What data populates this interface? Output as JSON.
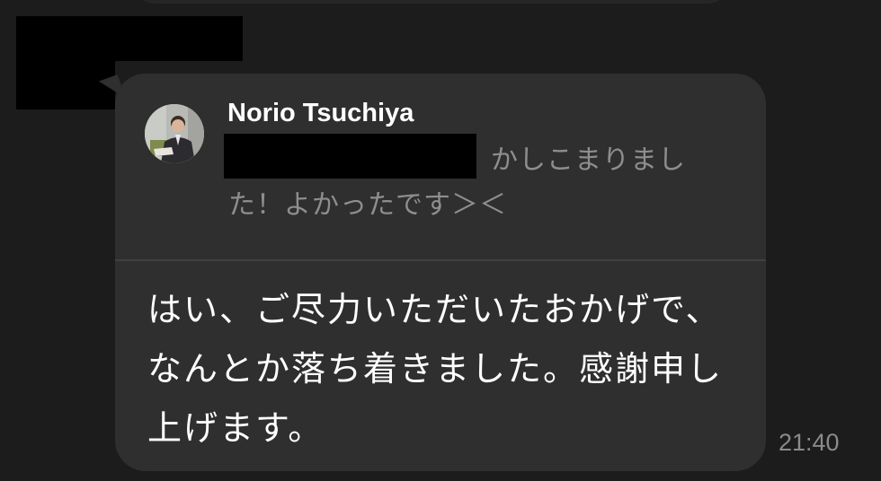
{
  "chat": {
    "reply": {
      "quoted_sender": "Norio Tsuchiya",
      "quoted_text": "かしこまりました！よかったです＞＜",
      "avatar_icon": "user-avatar-icon"
    },
    "message": {
      "text": "はい、ご尽力いただいたおかげで、なんとか落ち着きました。感謝申し上げます。",
      "time": "21:40"
    }
  },
  "colors": {
    "background": "#1c1c1c",
    "bubble": "#2f2f2f",
    "quoted_text": "#8e8e8e",
    "timestamp": "#8a8a8a"
  }
}
